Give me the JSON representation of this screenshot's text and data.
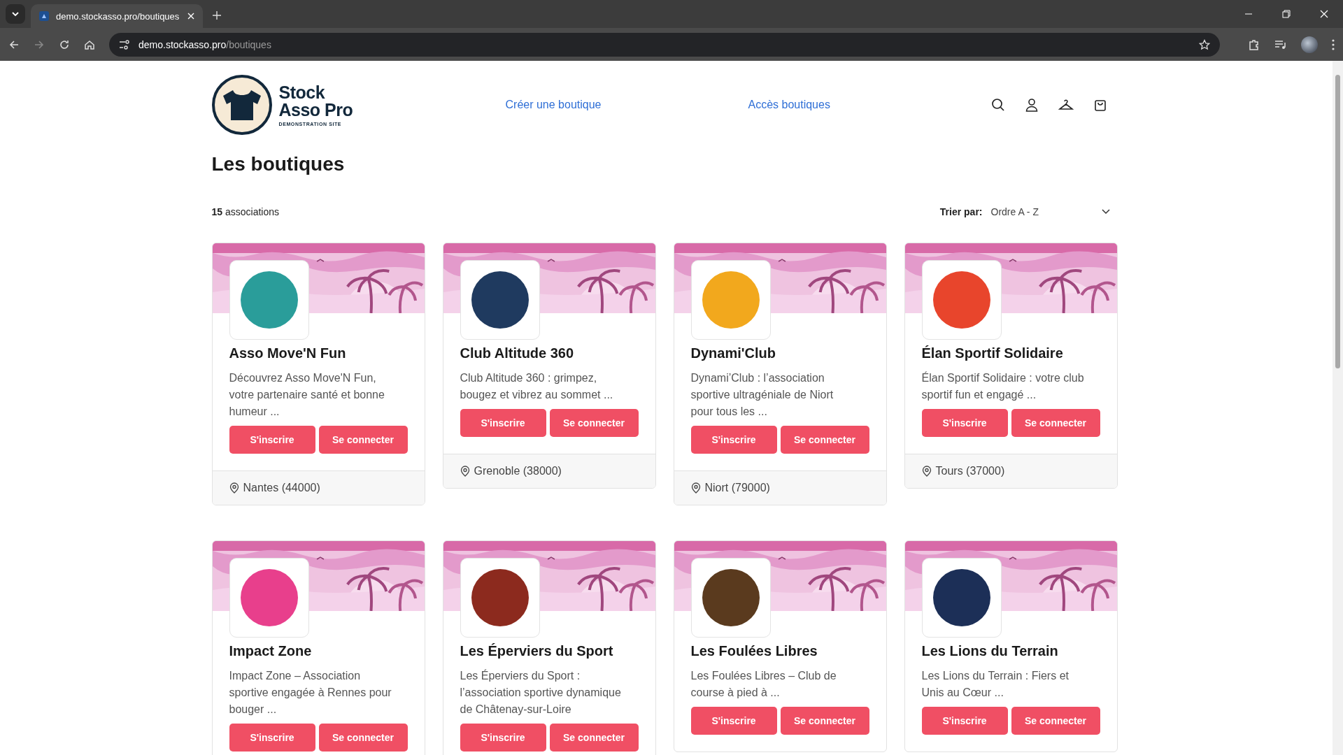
{
  "browser": {
    "tab_title": "demo.stockasso.pro/boutiques",
    "url_host": "demo.stockasso.pro",
    "url_path": "/boutiques"
  },
  "site": {
    "logo_line1": "Stock",
    "logo_line2": "Asso Pro",
    "logo_tagline": "DEMONSTRATION SITE",
    "nav": [
      "Créer une boutique",
      "Accès boutiques"
    ]
  },
  "page_title": "Les boutiques",
  "count": "**15** associations",
  "sort": {
    "label": "Trier par:",
    "value": "Ordre A - Z"
  },
  "cards": [
    {
      "name": "Asso Move'N Fun",
      "description": "Découvrez Asso Move'N Fun, votre partenaire santé et bonne humeur ...",
      "location": "Nantes (44000)",
      "color": "#2a9d9a",
      "buttons": [
        "S'inscrire",
        "Se connecter"
      ]
    },
    {
      "name": "Club Altitude 360",
      "description": "Club Altitude 360 : grimpez, bougez et vibrez au sommet ...",
      "location": "Grenoble (38000)",
      "color": "#1f3a5f",
      "buttons": [
        "S'inscrire",
        "Se connecter"
      ]
    },
    {
      "name": "Dynami'Club",
      "description": "Dynami’Club : l’association sportive ultragéniale de Niort pour tous les ...",
      "location": "Niort (79000)",
      "color": "#f2a81d",
      "buttons": [
        "S'inscrire",
        "Se connecter"
      ]
    },
    {
      "name": "Élan Sportif Solidaire",
      "description": "Élan Sportif Solidaire : votre club sportif fun et engagé ...",
      "location": "Tours (37000)",
      "color": "#e8452c",
      "buttons": [
        "S'inscrire",
        "Se connecter"
      ]
    },
    {
      "name": "Impact Zone",
      "description": "Impact Zone – Association sportive engagée à Rennes pour bouger ...",
      "color": "#e83f8c",
      "buttons": [
        "S'inscrire",
        "Se connecter"
      ]
    },
    {
      "name": "Les Éperviers du Sport",
      "description": "Les Éperviers du Sport : l’association sportive dynamique de Châtenay-sur-Loire",
      "color": "#8c2a1e",
      "buttons": [
        "S'inscrire",
        "Se connecter"
      ]
    },
    {
      "name": "Les Foulées Libres",
      "description": "Les Foulées Libres – Club de course à pied à ...",
      "color": "#5a3a1e",
      "buttons": [
        "S'inscrire",
        "Se connecter"
      ]
    },
    {
      "name": "Les Lions du Terrain",
      "description": "Les Lions du Terrain : Fiers et Unis au Cœur ...",
      "color": "#1c2f57",
      "buttons": [
        "S'inscrire",
        "Se connecter"
      ]
    }
  ]
}
